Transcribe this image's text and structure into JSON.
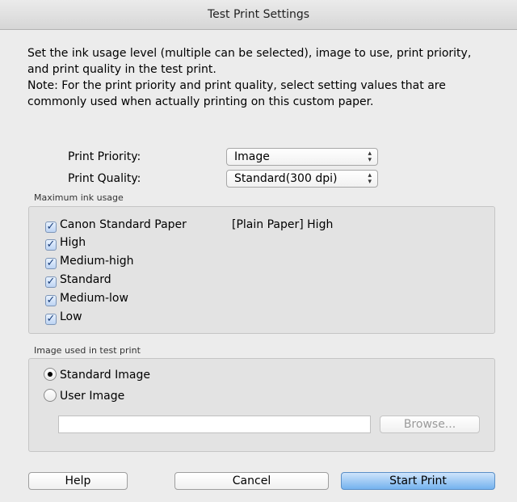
{
  "window": {
    "title": "Test Print Settings"
  },
  "description": [
    "Set the ink usage level (multiple can be selected), image to use, print priority,",
    "and print quality in the test print.",
    "Note: For the print priority and print quality, select setting values that are",
    "commonly used when actually printing on this custom paper."
  ],
  "print_priority": {
    "label": "Print Priority:",
    "value": "Image"
  },
  "print_quality": {
    "label": "Print Quality:",
    "value": "Standard(300 dpi)"
  },
  "ink_usage": {
    "title": "Maximum ink usage",
    "reference_value": "[Plain Paper] High",
    "items": [
      {
        "label": "Canon Standard Paper",
        "checked": true
      },
      {
        "label": "High",
        "checked": true
      },
      {
        "label": "Medium-high",
        "checked": true
      },
      {
        "label": "Standard",
        "checked": true
      },
      {
        "label": "Medium-low",
        "checked": true
      },
      {
        "label": "Low",
        "checked": true
      }
    ]
  },
  "image_group": {
    "title": "Image used in test print",
    "options": [
      {
        "label": "Standard Image",
        "selected": true
      },
      {
        "label": "User Image",
        "selected": false
      }
    ],
    "path_value": "",
    "browse_label": "Browse..."
  },
  "buttons": {
    "help": "Help",
    "cancel": "Cancel",
    "start": "Start Print"
  },
  "icons": {
    "check": "checkmark-icon",
    "popup_arrows": "up-down-arrows-icon"
  }
}
